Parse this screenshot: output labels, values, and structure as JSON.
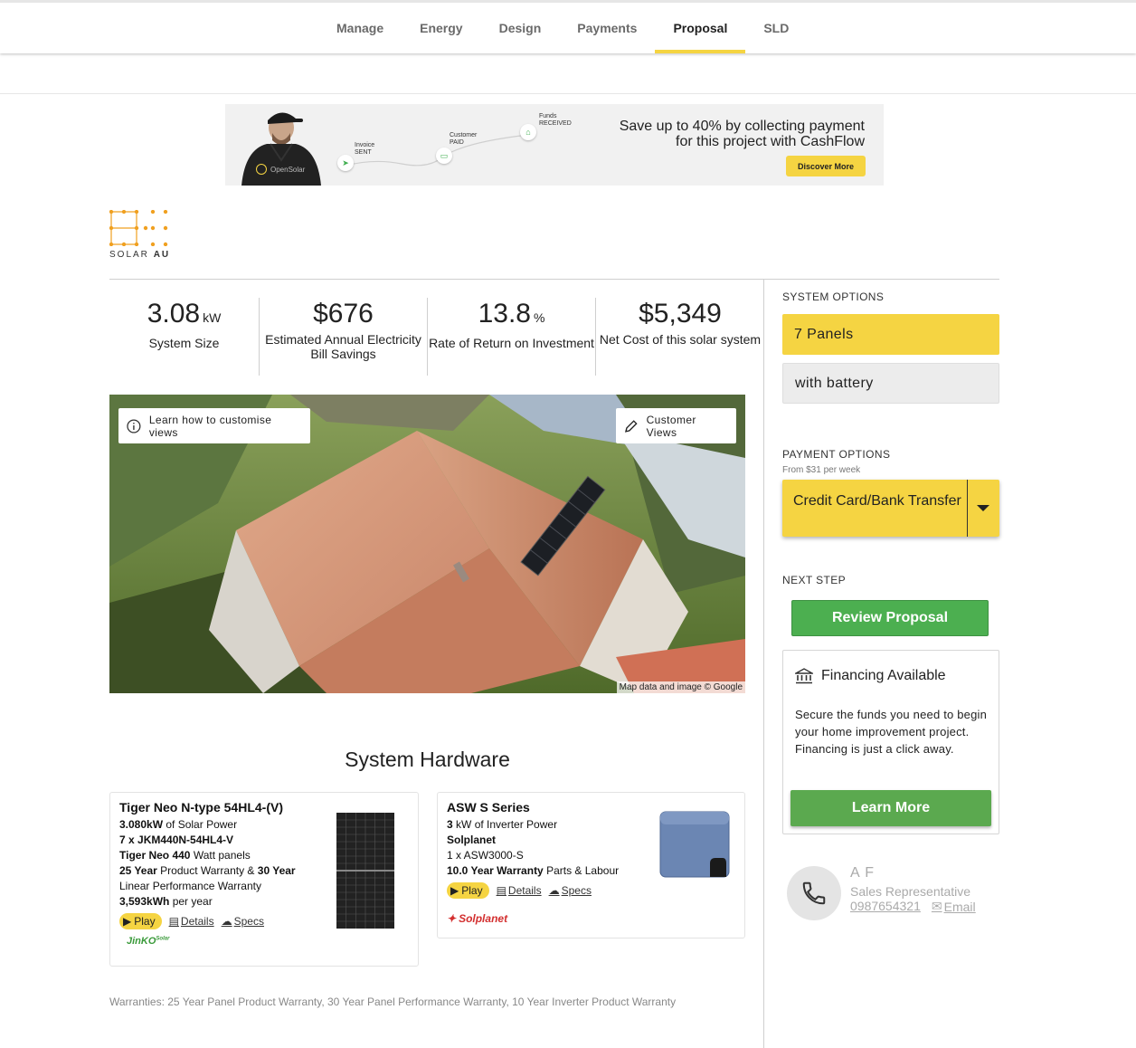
{
  "nav": {
    "tabs": [
      "Manage",
      "Energy",
      "Design",
      "Payments",
      "Proposal",
      "SLD"
    ],
    "active": "Proposal"
  },
  "banner": {
    "step1": "Invoice SENT",
    "step2": "Customer PAID",
    "step3": "Funds RECEIVED",
    "shirt_logo": "OpenSolar",
    "headline_line1": "Save up to 40% by collecting payment",
    "headline_line2": "for this project with CashFlow",
    "cta": "Discover More",
    "accent": "#f5d442"
  },
  "logo": {
    "text_light": "SOLAR",
    "text_bold": "AU",
    "color": "#f0a020"
  },
  "stats": [
    {
      "value": "3.08",
      "unit": "kW",
      "label": "System Size"
    },
    {
      "value": "$676",
      "unit": "",
      "label": "Estimated Annual Electricity Bill Savings"
    },
    {
      "value": "13.8",
      "unit": "%",
      "label": "Rate of Return on Investment"
    },
    {
      "value": "$5,349",
      "unit": "",
      "label": "Net Cost of this solar system"
    }
  ],
  "map": {
    "learn_button": "Learn how to customise views",
    "views_button": "Customer Views",
    "credit": "Map data and image © Google",
    "info_icon": "info-icon",
    "edit_icon": "pencil-icon"
  },
  "hardware": {
    "title": "System Hardware",
    "panel": {
      "name": "Tiger Neo N-type 54HL4-(V)",
      "power_bold": "3.080kW",
      "power_rest": "of Solar Power",
      "model": "7 x JKM440N-54HL4-V",
      "watt_bold": "Tiger Neo 440",
      "watt_rest": "Watt panels",
      "warranty_a_bold": "25 Year",
      "warranty_a_rest": "Product Warranty &",
      "warranty_b_bold": "30 Year",
      "warranty_b_rest": "Linear Performance Warranty",
      "yield_bold": "3,593kWh",
      "yield_rest": "per year",
      "play": "Play",
      "details": "Details",
      "specs": "Specs",
      "brand": "JinKO",
      "brand_sup": "Solar"
    },
    "inverter": {
      "name": "ASW S Series",
      "power_bold": "3",
      "power_rest": "kW of Inverter Power",
      "maker": "Solplanet",
      "model": "1 x ASW3000-S",
      "warranty_bold": "10.0 Year Warranty",
      "warranty_rest": "Parts & Labour",
      "play": "Play",
      "details": "Details",
      "specs": "Specs",
      "brand": "Solplanet"
    },
    "warranties": "Warranties: 25 Year Panel Product Warranty, 30 Year Panel Performance Warranty, 10 Year Inverter Product Warranty"
  },
  "sidebar": {
    "system_options_label": "SYSTEM OPTIONS",
    "option_selected": "7 Panels",
    "option_other": "with battery",
    "payment_options_label": "PAYMENT OPTIONS",
    "payment_from": "From $31 per week",
    "payment_selected": "Credit Card/Bank Transfer",
    "next_step_label": "NEXT STEP",
    "review_button": "Review Proposal",
    "financing_title": "Financing Available",
    "financing_body": "Secure the funds you need to begin your home improvement project. Financing is just a click away.",
    "learn_more": "Learn More",
    "rep_name": "A F",
    "rep_role": "Sales Representative",
    "rep_phone": "0987654321",
    "rep_email": "Email",
    "green": "#4caf50"
  }
}
